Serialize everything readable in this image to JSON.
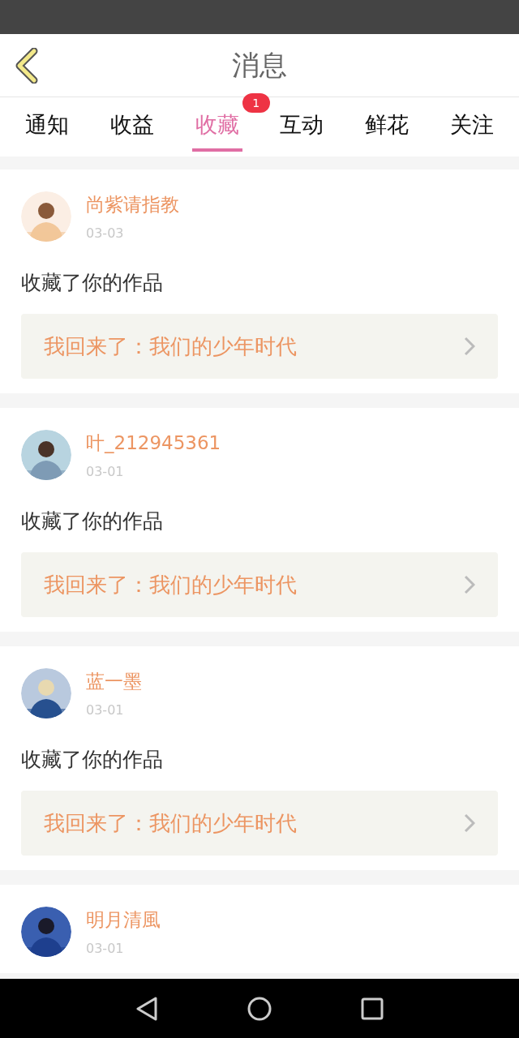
{
  "header": {
    "title": "消息"
  },
  "tabs": [
    {
      "label": "通知",
      "selected": false
    },
    {
      "label": "收益",
      "selected": false
    },
    {
      "label": "收藏",
      "selected": true,
      "badge": "1"
    },
    {
      "label": "互动",
      "selected": false
    },
    {
      "label": "鲜花",
      "selected": false
    },
    {
      "label": "关注",
      "selected": false
    }
  ],
  "messages": [
    {
      "user": "尚紫请指教",
      "date": "03-03",
      "action": "收藏了你的作品",
      "work": "我回来了：我们的少年时代"
    },
    {
      "user": "叶_212945361",
      "date": "03-01",
      "action": "收藏了你的作品",
      "work": "我回来了：我们的少年时代"
    },
    {
      "user": "蓝一墨",
      "date": "03-01",
      "action": "收藏了你的作品",
      "work": "我回来了：我们的少年时代"
    },
    {
      "user": "明月清風",
      "date": "03-01"
    }
  ]
}
